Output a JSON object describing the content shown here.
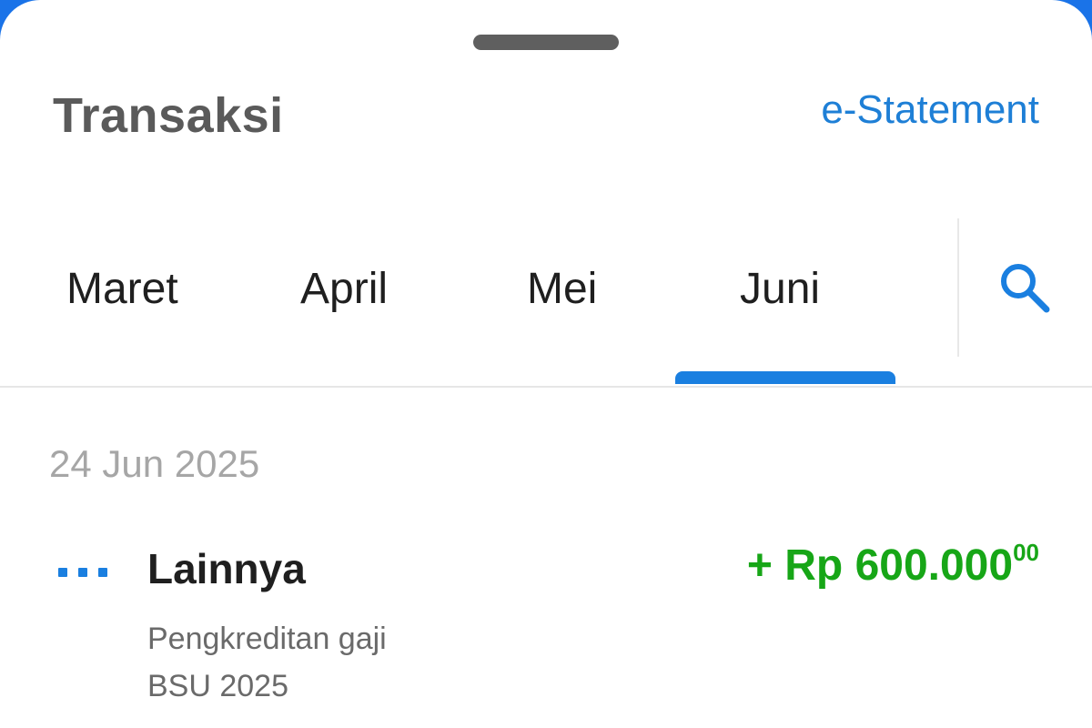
{
  "header": {
    "title": "Transaksi",
    "estatement_label": "e-Statement"
  },
  "tabs": {
    "items": [
      {
        "label": "Maret"
      },
      {
        "label": "April"
      },
      {
        "label": "Mei"
      },
      {
        "label": "Juni"
      }
    ],
    "selected": "Juni",
    "search_icon": "search-icon"
  },
  "transactions": {
    "groups": [
      {
        "date": "24 Jun 2025",
        "items": [
          {
            "icon": "more-dots-icon",
            "category": "Lainnya",
            "description_line1": "Pengkreditan gaji",
            "description_line2": "BSU 2025",
            "amount_main": "+ Rp 600.000",
            "amount_decimals": "00"
          }
        ]
      }
    ]
  },
  "colors": {
    "accent": "#1a7fe0",
    "link": "#1e7fd6",
    "credit": "#17a617",
    "muted": "#a6a6a6"
  }
}
